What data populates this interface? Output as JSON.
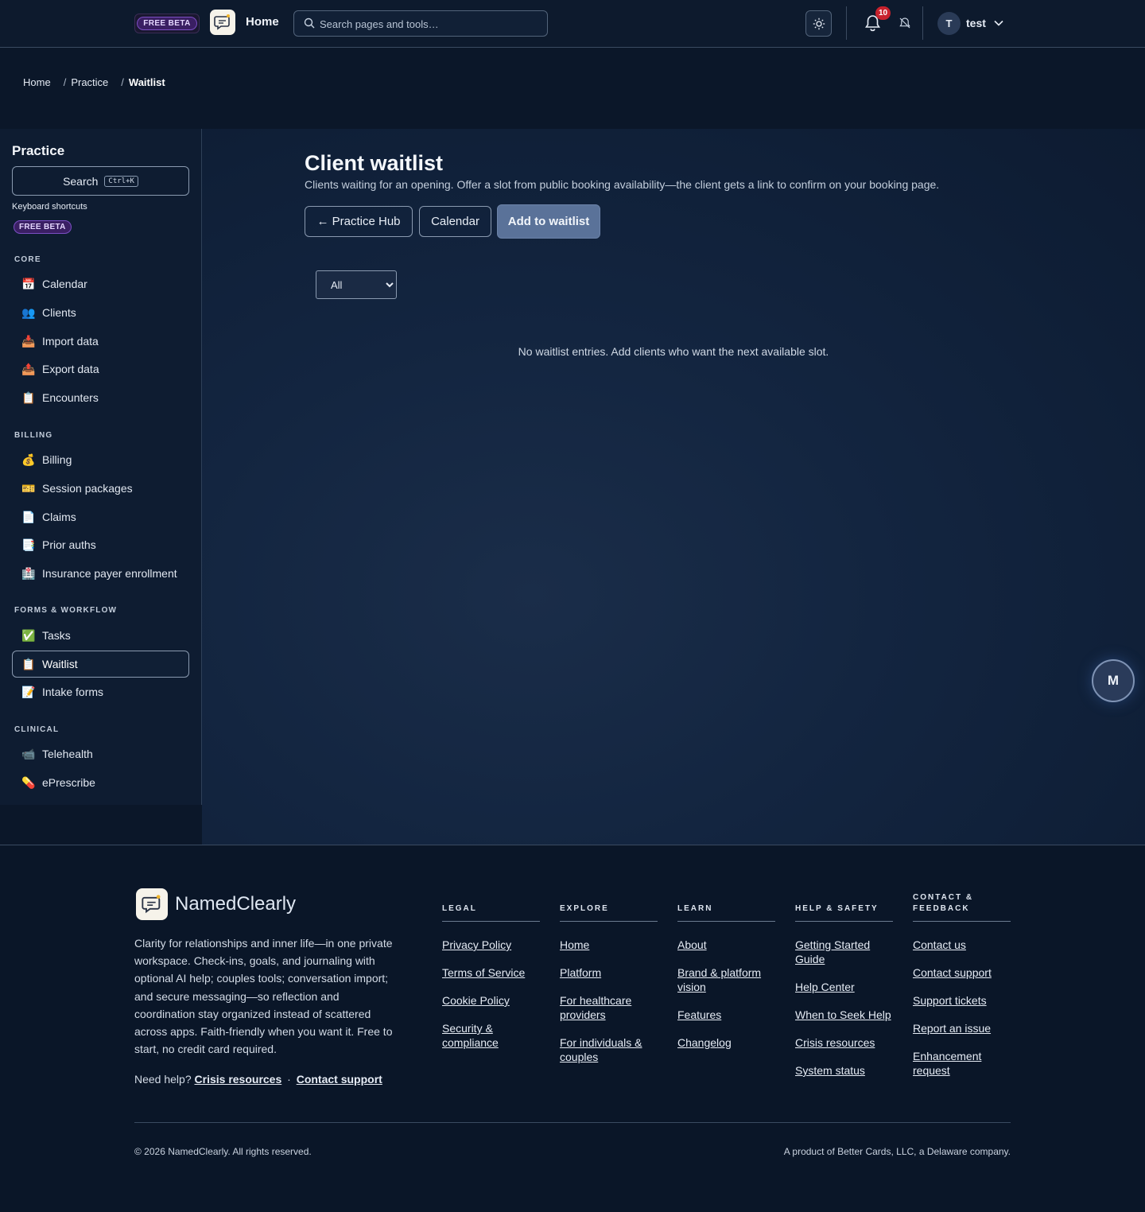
{
  "header": {
    "beta_badge": "FREE BETA",
    "home_label": "Home",
    "search_placeholder": "Search pages and tools…",
    "notification_count": "10",
    "user_initial": "T",
    "user_name": "test"
  },
  "breadcrumb": {
    "items": [
      "Home",
      "Practice",
      "Waitlist"
    ],
    "separator": "/"
  },
  "sidebar": {
    "title": "Practice",
    "search_label": "Search",
    "search_shortcut": "Ctrl+K",
    "keyboard_shortcuts": "Keyboard shortcuts",
    "beta_badge": "FREE BETA",
    "sections": [
      {
        "label": "CORE",
        "items": [
          {
            "icon": "📅",
            "label": "Calendar"
          },
          {
            "icon": "👥",
            "label": "Clients"
          },
          {
            "icon": "📥",
            "label": "Import data"
          },
          {
            "icon": "📤",
            "label": "Export data"
          },
          {
            "icon": "📋",
            "label": "Encounters"
          }
        ]
      },
      {
        "label": "BILLING",
        "items": [
          {
            "icon": "💰",
            "label": "Billing"
          },
          {
            "icon": "🎫",
            "label": "Session packages"
          },
          {
            "icon": "📄",
            "label": "Claims"
          },
          {
            "icon": "📑",
            "label": "Prior auths"
          },
          {
            "icon": "🏥",
            "label": "Insurance payer enrollment"
          }
        ]
      },
      {
        "label": "FORMS & WORKFLOW",
        "items": [
          {
            "icon": "✅",
            "label": "Tasks"
          },
          {
            "icon": "📋",
            "label": "Waitlist",
            "active": true
          },
          {
            "icon": "📝",
            "label": "Intake forms"
          }
        ]
      },
      {
        "label": "CLINICAL",
        "items": [
          {
            "icon": "📹",
            "label": "Telehealth"
          },
          {
            "icon": "💊",
            "label": "ePrescribe"
          }
        ]
      }
    ]
  },
  "main": {
    "title": "Client waitlist",
    "subtitle": "Clients waiting for an opening. Offer a slot from public booking availability—the client gets a link to confirm on your booking page.",
    "buttons": {
      "practice_hub": "← Practice Hub",
      "calendar": "Calendar",
      "add": "Add to waitlist"
    },
    "filter": {
      "selected": "All",
      "options": [
        "All"
      ]
    },
    "empty_message": "No waitlist entries. Add clients who want the next available slot.",
    "fab_label": "M"
  },
  "footer": {
    "brand": "NamedClearly",
    "blurb": "Clarity for relationships and inner life—in one private workspace. Check-ins, goals, and journaling with optional AI help; couples tools; conversation import; and secure messaging—so reflection and coordination stay organized instead of scattered across apps. Faith-friendly when you want it. Free to start, no credit card required.",
    "help_prefix": "Need help?",
    "help_crisis": "Crisis resources",
    "help_dot": "·",
    "help_contact": "Contact support",
    "columns": [
      {
        "heading": "LEGAL",
        "links": [
          "Privacy Policy",
          "Terms of Service",
          "Cookie Policy",
          "Security & compliance"
        ]
      },
      {
        "heading": "EXPLORE",
        "links": [
          "Home",
          "Platform",
          "For healthcare providers",
          "For individuals & couples"
        ]
      },
      {
        "heading": "LEARN",
        "links": [
          "About",
          "Brand & platform vision",
          "Features",
          "Changelog"
        ]
      },
      {
        "heading": "HELP & SAFETY",
        "links": [
          "Getting Started Guide",
          "Help Center",
          "When to Seek Help",
          "Crisis resources",
          "System status"
        ]
      },
      {
        "heading": "CONTACT & FEEDBACK",
        "links": [
          "Contact us",
          "Contact support",
          "Support tickets",
          "Report an issue",
          "Enhancement request"
        ]
      }
    ],
    "copyright": "© 2026 NamedClearly. All rights reserved.",
    "product_line": "A product of Better Cards, LLC, a Delaware company."
  }
}
